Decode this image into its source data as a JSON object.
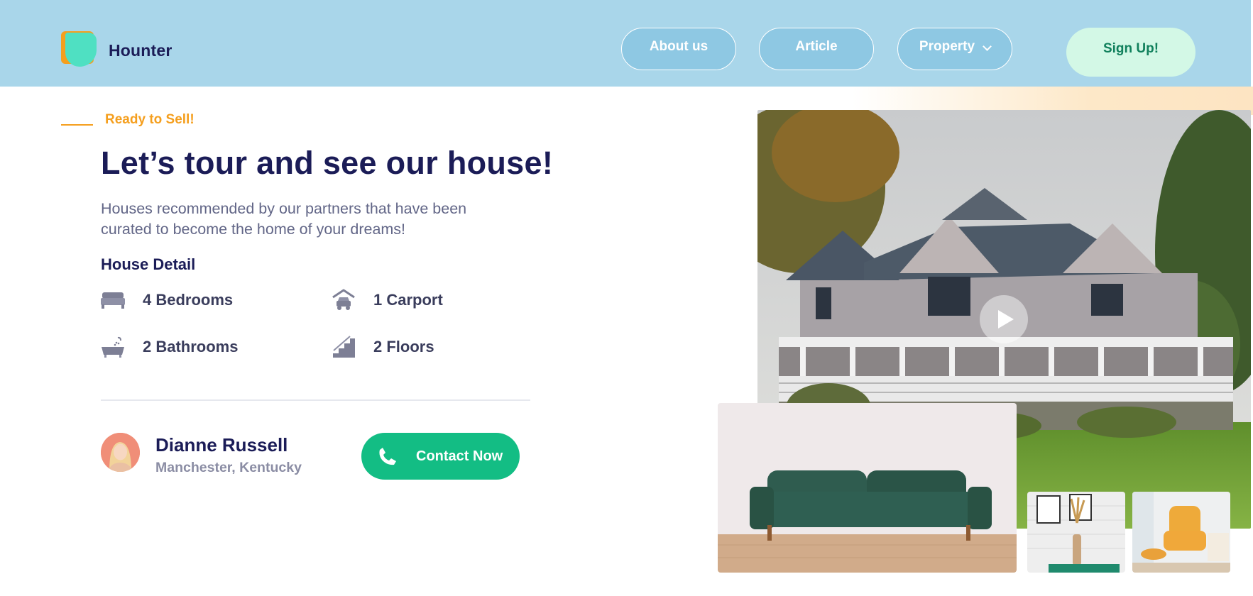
{
  "header": {
    "brand": "Hounter",
    "nav": {
      "about": "About us",
      "article": "Article",
      "property": "Property"
    },
    "signup": "Sign Up!"
  },
  "hero": {
    "eyebrow": "Ready to Sell!",
    "headline": "Let’s tour and see our house!",
    "description": "Houses recommended by our partners that have been curated to become the home of your dreams!",
    "detail_title": "House Detail",
    "features": {
      "bedrooms": "4 Bedrooms",
      "carport": "1 Carport",
      "bathrooms": "2 Bathrooms",
      "floors": "2 Floors"
    }
  },
  "agent": {
    "name": "Dianne Russell",
    "location": "Manchester, Kentucky",
    "contact_label": "Contact Now"
  },
  "icons": {
    "bed": "bed-icon",
    "carport": "car-garage-icon",
    "bath": "bathtub-icon",
    "floors": "stairs-icon",
    "phone": "phone-icon",
    "play": "play-icon"
  },
  "colors": {
    "header_bg": "#a9d6ea",
    "navy": "#1b1c57",
    "orange": "#f59f1e",
    "green": "#13bd84",
    "mint": "#d3f8e6"
  }
}
